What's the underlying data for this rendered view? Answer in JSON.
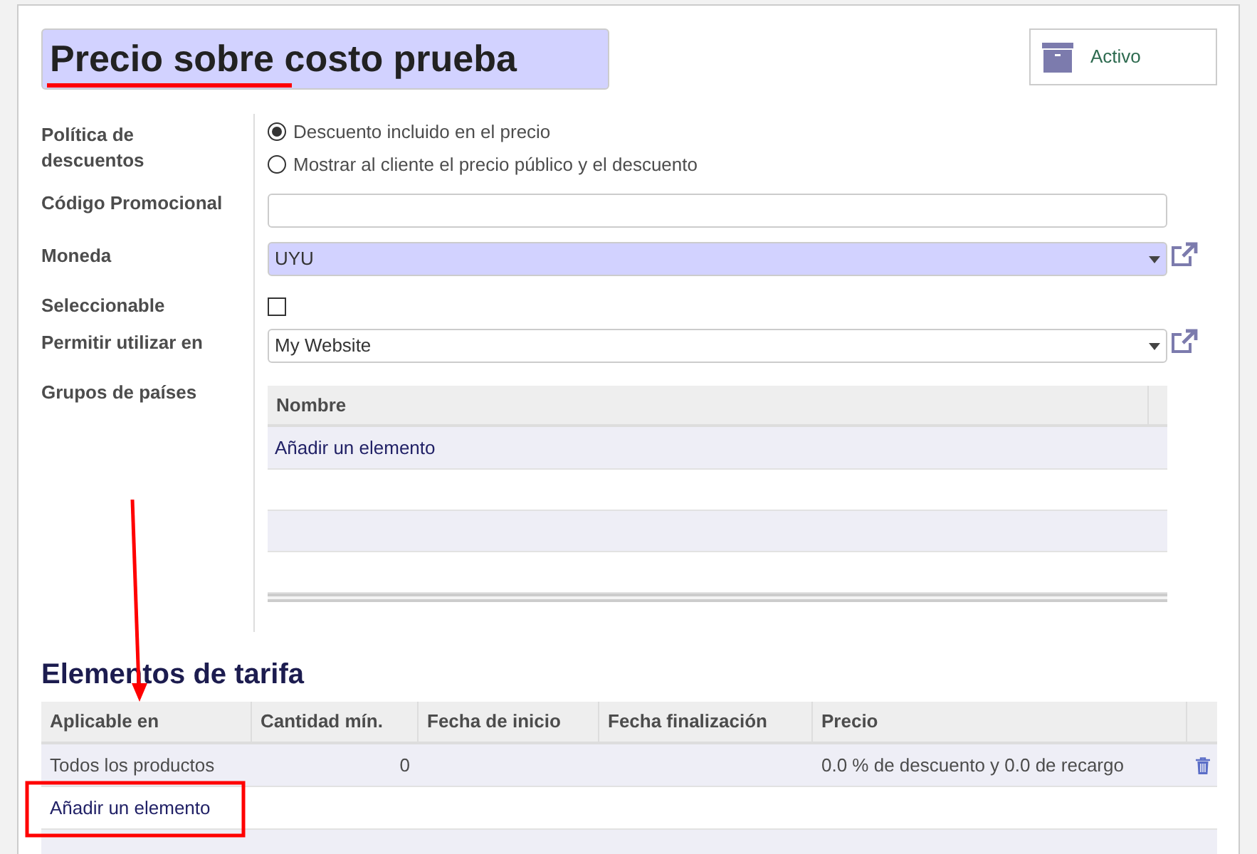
{
  "title": "Precio sobre costo prueba",
  "archive_button": {
    "label": "Activo"
  },
  "fields": [
    {
      "kind": "radio",
      "label": "Política de descuentos",
      "options": [
        {
          "label": "Descuento incluido en el precio",
          "selected": true
        },
        {
          "label": "Mostrar al cliente el precio público y el descuento",
          "selected": false
        }
      ]
    },
    {
      "kind": "text",
      "label": "Código Promocional"
    },
    {
      "kind": "select",
      "label": "Moneda",
      "value": "UYU",
      "required": true
    },
    {
      "kind": "checkbox",
      "label": "Seleccionable",
      "checked": false
    },
    {
      "kind": "select",
      "label": "Permitir utilizar en",
      "value": "My Website",
      "required": false
    },
    {
      "kind": "table",
      "label": "Grupos de países",
      "columns": [
        "Nombre"
      ],
      "add_link": "Añadir un elemento"
    }
  ],
  "items_section": {
    "title": "Elementos de tarifa",
    "columns": [
      "Aplicable en",
      "Cantidad mín.",
      "Fecha de inicio",
      "Fecha finalización",
      "Precio"
    ],
    "rows": [
      [
        "Todos los productos",
        "0",
        "",
        "",
        "0.0 % de descuento y 0.0 de recargo"
      ]
    ],
    "add_link": "Añadir un elemento"
  }
}
